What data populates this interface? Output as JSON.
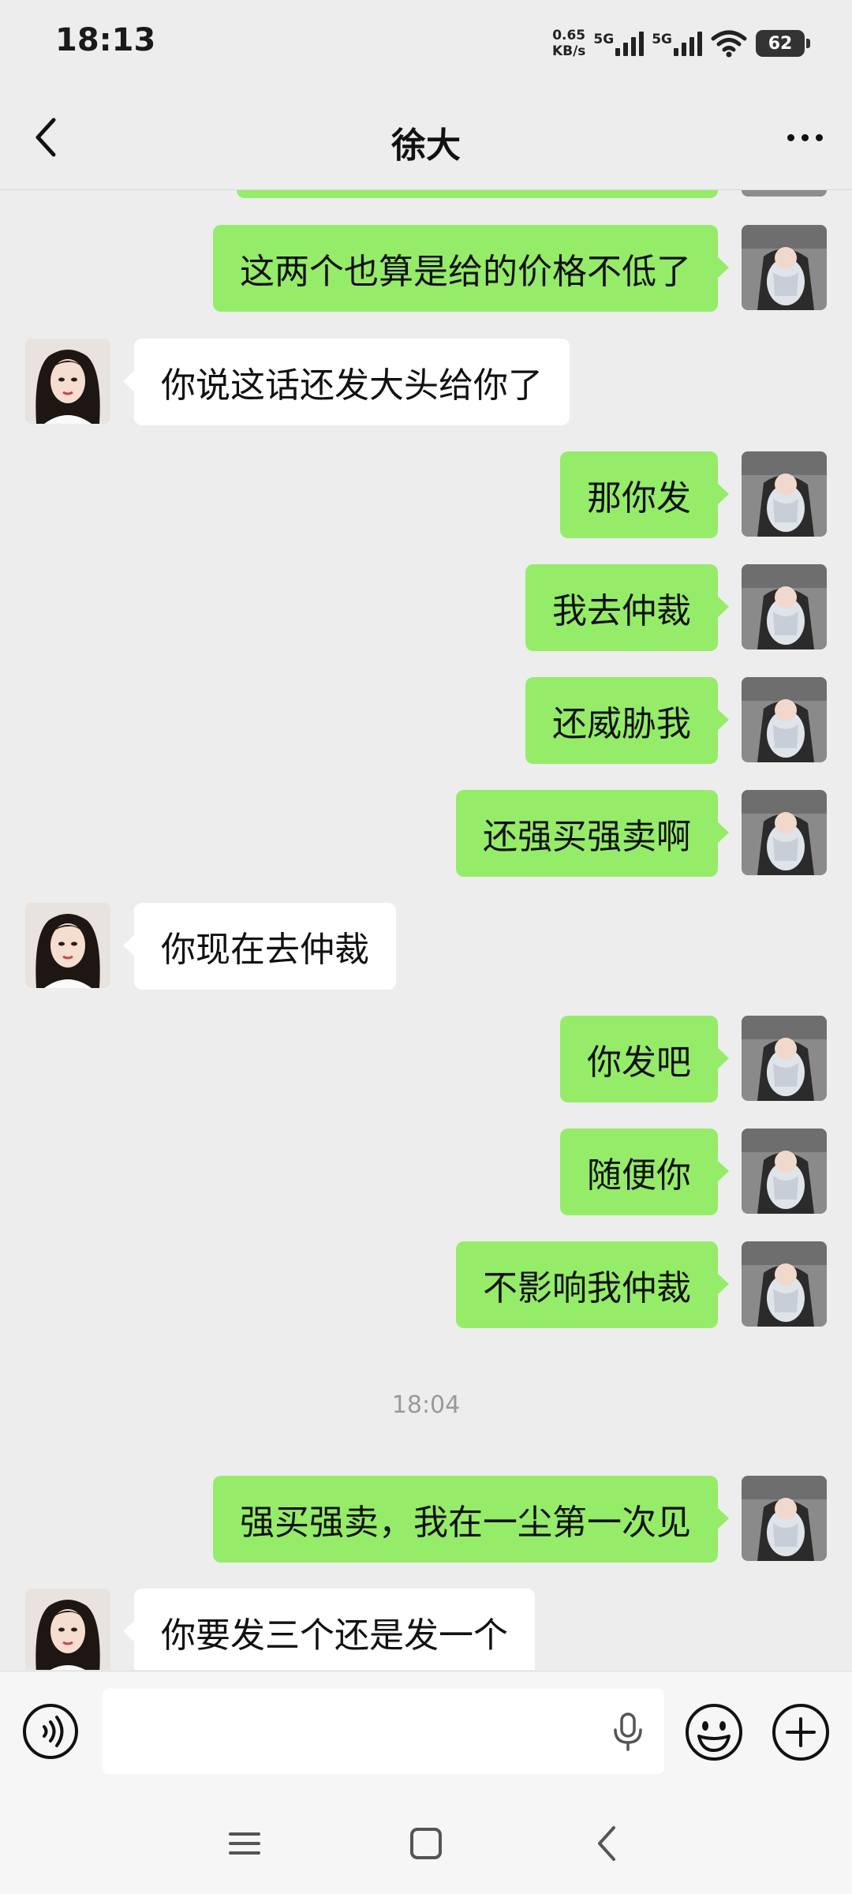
{
  "status_bar": {
    "time": "18:13",
    "net_speed_value": "0.65",
    "net_speed_unit": "KB/s",
    "signal1_label": "5G",
    "signal2_label": "5G",
    "battery": "62"
  },
  "header": {
    "title": "徐大"
  },
  "messages": [
    {
      "side": "me",
      "text": "这两个也算是给的价格不低了"
    },
    {
      "side": "other",
      "text": "你说这话还发大头给你了"
    },
    {
      "side": "me",
      "text": "那你发"
    },
    {
      "side": "me",
      "text": "我去仲裁"
    },
    {
      "side": "me",
      "text": "还威胁我"
    },
    {
      "side": "me",
      "text": "还强买强卖啊"
    },
    {
      "side": "other",
      "text": "你现在去仲裁"
    },
    {
      "side": "me",
      "text": "你发吧"
    },
    {
      "side": "me",
      "text": "随便你"
    },
    {
      "side": "me",
      "text": "不影响我仲裁"
    },
    {
      "side": "me",
      "text": "强买强卖，我在一尘第一次见"
    },
    {
      "side": "other",
      "text": "你要发三个还是发一个"
    }
  ],
  "timestamp": "18:04",
  "input": {
    "value": "",
    "placeholder": ""
  },
  "icons": {
    "back": "chevron-left-icon",
    "more": "more-dots-icon",
    "voice": "voice-input-icon",
    "mic": "microphone-icon",
    "emoji": "emoji-icon",
    "plus": "plus-icon"
  },
  "colors": {
    "my_bubble": "#95ec69",
    "other_bubble": "#ffffff",
    "chat_background": "#ededed"
  }
}
